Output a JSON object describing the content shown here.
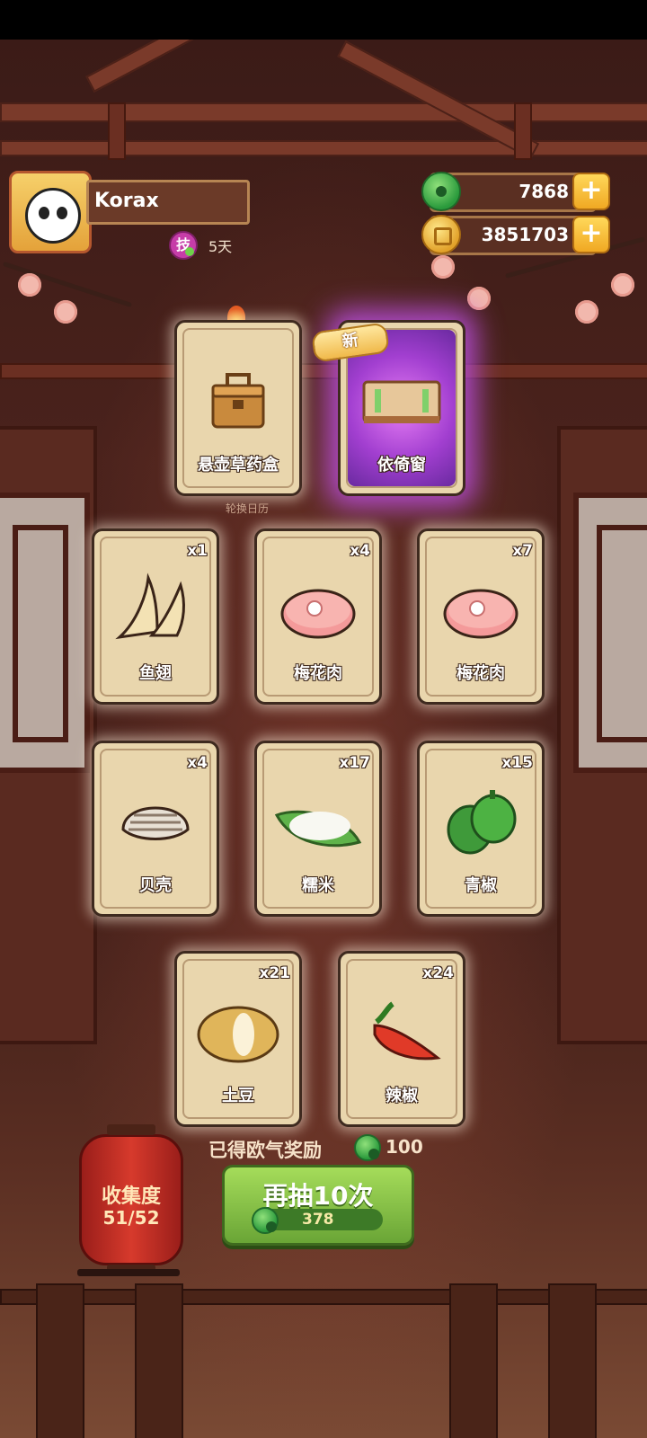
{
  "player": {
    "name": "Korax",
    "skill_icon_label": "技",
    "days": "5天"
  },
  "resources": {
    "jade": "7868",
    "coins": "3851703"
  },
  "cards": [
    {
      "label": "悬壶草药盒",
      "qty": "",
      "art": "herb-box"
    },
    {
      "label": "依倚窗",
      "qty": "",
      "art": "window-frame",
      "rarity": "purple",
      "new_tag": "新"
    },
    {
      "label": "鱼翅",
      "qty": "x1",
      "art": "shark-fin"
    },
    {
      "label": "梅花肉",
      "qty": "x4",
      "art": "pork"
    },
    {
      "label": "梅花肉",
      "qty": "x7",
      "art": "pork"
    },
    {
      "label": "贝壳",
      "qty": "x4",
      "art": "shell"
    },
    {
      "label": "糯米",
      "qty": "x17",
      "art": "rice"
    },
    {
      "label": "青椒",
      "qty": "x15",
      "art": "green-pepper"
    },
    {
      "label": "土豆",
      "qty": "x21",
      "art": "potato"
    },
    {
      "label": "辣椒",
      "qty": "x24",
      "art": "chili"
    }
  ],
  "calendar_label": "轮换日历",
  "reward": {
    "text": "已得欧气奖励",
    "value": "100"
  },
  "collection": {
    "title": "收集度",
    "progress": "51/52"
  },
  "draw_button": {
    "label": "再抽10次",
    "cost": "378"
  }
}
